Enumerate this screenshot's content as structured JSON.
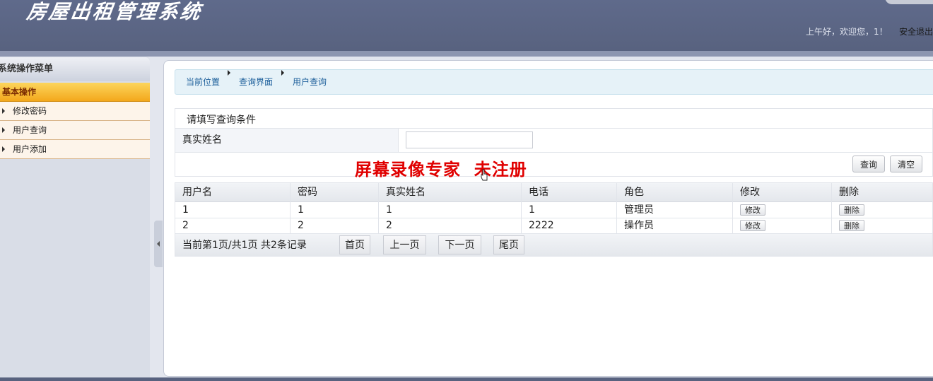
{
  "header": {
    "title": "房屋出租管理系统",
    "greeting": "上午好，欢迎您，1！",
    "logout_label": "安全退出"
  },
  "sidebar": {
    "title": "系统操作菜单",
    "section": "基本操作",
    "items": [
      {
        "label": "修改密码"
      },
      {
        "label": "用户查询"
      },
      {
        "label": "用户添加"
      }
    ]
  },
  "breadcrumb": {
    "items": [
      "当前位置",
      "查询界面",
      "用户查询"
    ]
  },
  "query": {
    "title": "请填写查询条件",
    "field_label": "真实姓名",
    "field_value": "",
    "search_label": "查询",
    "clear_label": "清空"
  },
  "watermark": "屏幕录像专家  未注册",
  "table": {
    "columns": [
      "用户名",
      "密码",
      "真实姓名",
      "电话",
      "角色",
      "修改",
      "删除"
    ],
    "rows": [
      {
        "username": "1",
        "password": "1",
        "realname": "1",
        "phone": "1",
        "role": "管理员",
        "edit": "修改",
        "delete": "删除"
      },
      {
        "username": "2",
        "password": "2",
        "realname": "2",
        "phone": "2222",
        "role": "操作员",
        "edit": "修改",
        "delete": "删除"
      }
    ]
  },
  "pager": {
    "info": "当前第1页/共1页  共2条记录",
    "first": "首页",
    "prev": "上一页",
    "next": "下一页",
    "last": "尾页"
  },
  "colors": {
    "header_bg": "#5f6a8b",
    "sidebar_section": "#f3a81c",
    "breadcrumb_bg": "#e6f2f8",
    "watermark": "#e00000"
  }
}
